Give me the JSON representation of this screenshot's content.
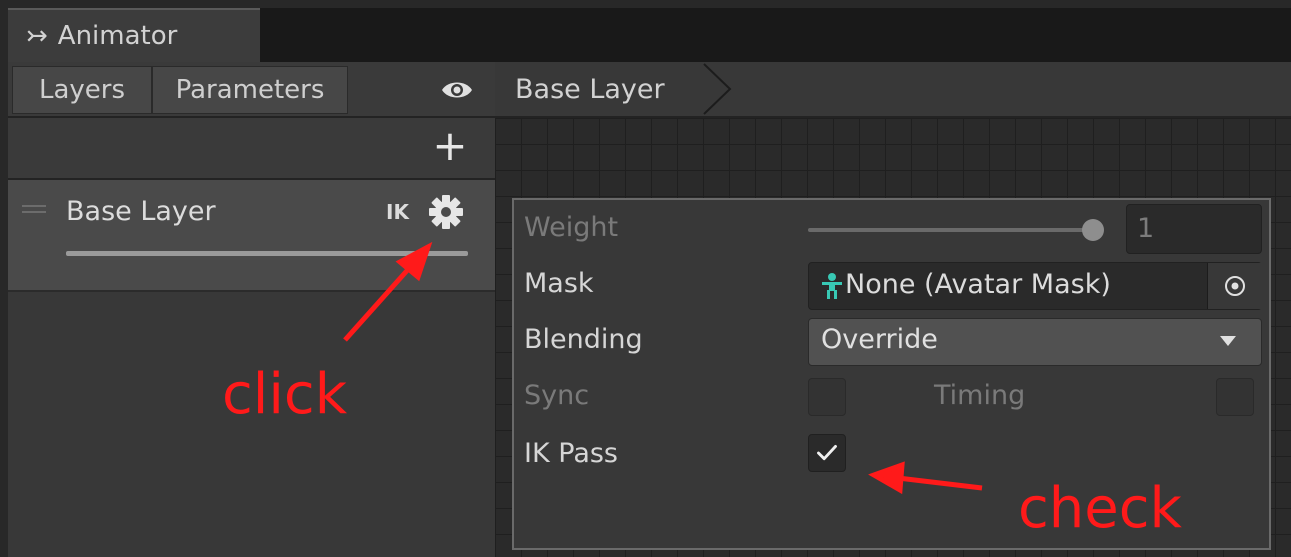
{
  "window": {
    "tab_title": "Animator",
    "tab_icon": "animator-icon"
  },
  "left_panel": {
    "tabs": [
      {
        "label": "Layers",
        "selected": true
      },
      {
        "label": "Parameters",
        "selected": false
      }
    ],
    "visibility_icon": "eye-icon",
    "add_icon": "plus-icon",
    "layers": [
      {
        "name": "Base Layer",
        "badge": "IK",
        "settings_icon": "gear-icon"
      }
    ]
  },
  "graph": {
    "breadcrumb": "Base Layer"
  },
  "layer_settings": {
    "weight": {
      "label": "Weight",
      "value": "1",
      "enabled": false
    },
    "mask": {
      "label": "Mask",
      "value": "None (Avatar Mask)",
      "icon": "avatar-mask-icon"
    },
    "blending": {
      "label": "Blending",
      "value": "Override"
    },
    "sync": {
      "label": "Sync",
      "checked": false,
      "enabled": false
    },
    "timing": {
      "label": "Timing",
      "checked": false,
      "enabled": false
    },
    "ik_pass": {
      "label": "IK Pass",
      "checked": true
    }
  },
  "annotations": {
    "click_label": "click",
    "check_label": "check",
    "color": "#ff1a1a"
  },
  "colors": {
    "mask_icon": "#38c8b4",
    "background": "#282828",
    "panel": "#383838"
  }
}
